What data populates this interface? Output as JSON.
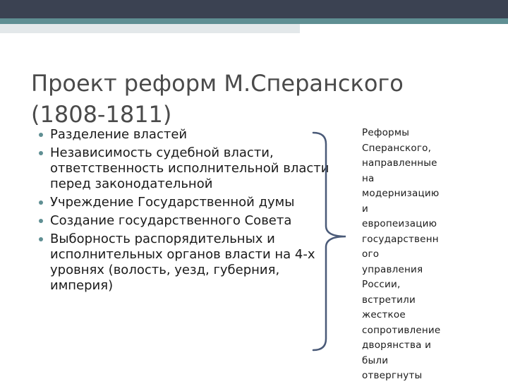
{
  "slide": {
    "title": "Проект реформ М.Сперанского\n(1808-1811)",
    "bullets": [
      "Разделение властей",
      "Независимость судебной власти, ответственность исполнительной власти перед законодательной",
      "Учреждение Государственной думы",
      "Создание государственного Совета",
      "Выборность распорядительных и исполнительных органов власти  на 4-х уровнях (волость, уезд, губерния, империя)"
    ],
    "side_note": "Реформы\nСперанского,\nнаправленные\nна\nмодернизацию\nи\nевропеизацию\nгосударственн\nого\nуправления\nРоссии,\nвстретили\nжесткое\nсопротивление\nдворянства и\nбыли\nотвергнуты"
  },
  "colors": {
    "top_bar": "#3b4252",
    "accent": "#5f8f93",
    "light_band": "#e3e8ea",
    "brace": "#4a5a78"
  }
}
